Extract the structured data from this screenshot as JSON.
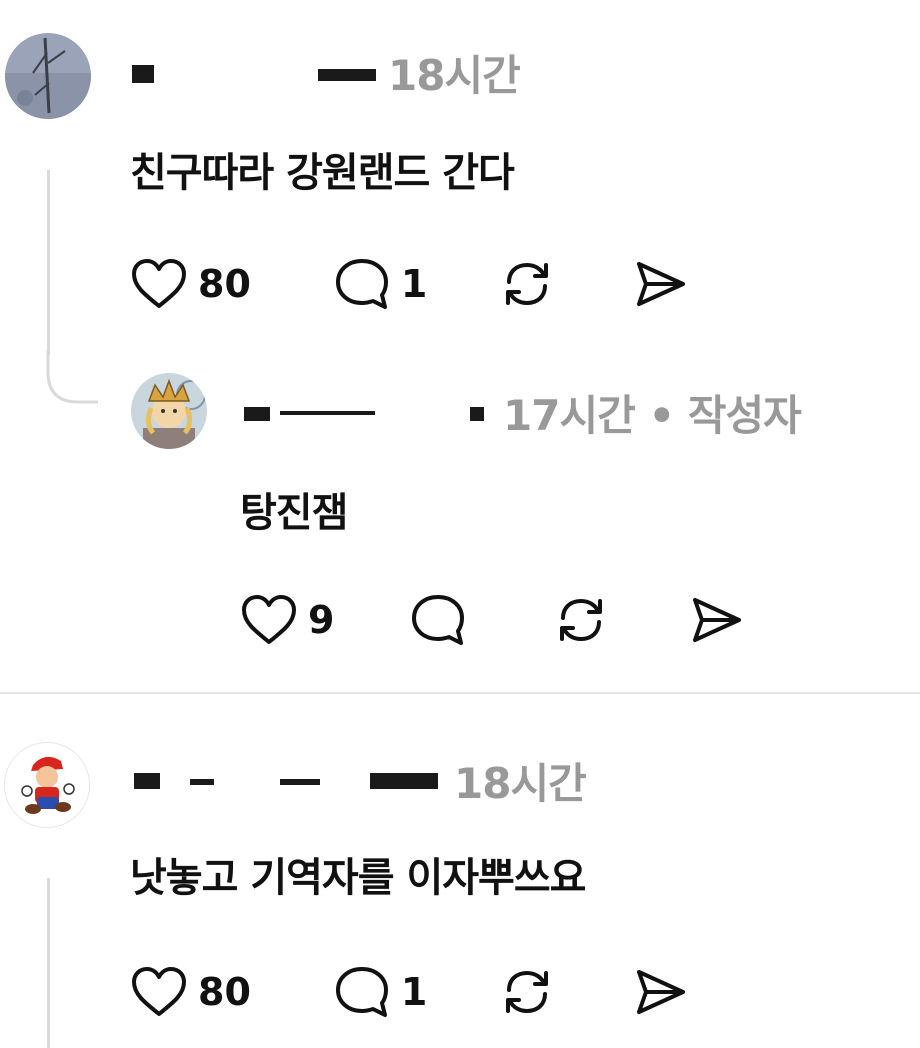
{
  "comments": [
    {
      "time": "18시간",
      "text": "친구따라 강원랜드 간다",
      "likes": "80",
      "replies": "1"
    },
    {
      "time": "17시간 • 작성자",
      "text": "탕진잼",
      "likes": "9",
      "replies": ""
    },
    {
      "time": "18시간",
      "text": "낫놓고 기역자를 이자뿌쓰요",
      "likes": "80",
      "replies": "1"
    }
  ],
  "icons": {
    "like": "heart-icon",
    "reply": "speech-bubble-icon",
    "repost": "repost-icon",
    "share": "send-icon"
  },
  "colors": {
    "text": "#111111",
    "meta_gray": "#999999",
    "thread_line": "#d9d9d9"
  }
}
